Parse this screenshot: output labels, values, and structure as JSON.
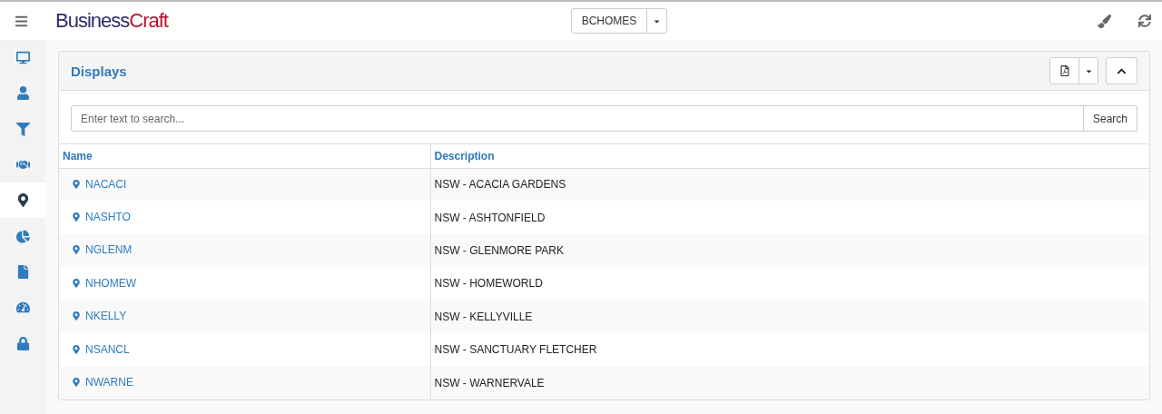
{
  "header": {
    "logo": {
      "text": "Business",
      "accent": "Craft"
    },
    "company": "BCHOMES"
  },
  "sidebar": {
    "items": [
      {
        "selected": false
      },
      {
        "selected": false
      },
      {
        "selected": false
      },
      {
        "selected": false
      },
      {
        "selected": true
      },
      {
        "selected": false
      },
      {
        "selected": false
      },
      {
        "selected": false
      },
      {
        "selected": false
      }
    ]
  },
  "panel": {
    "title": "Displays",
    "search": {
      "placeholder": "Enter text to search...",
      "button": "Search"
    },
    "table": {
      "columns": [
        "Name",
        "Description"
      ],
      "rows": [
        {
          "name": "NACACI",
          "description": "NSW - ACACIA GARDENS"
        },
        {
          "name": "NASHTO",
          "description": "NSW - ASHTONFIELD"
        },
        {
          "name": "NGLENM",
          "description": "NSW - GLENMORE PARK"
        },
        {
          "name": "NHOMEW",
          "description": "NSW - HOMEWORLD"
        },
        {
          "name": "NKELLY",
          "description": "NSW - KELLYVILLE"
        },
        {
          "name": "NSANCL",
          "description": "NSW - SANCTUARY FLETCHER"
        },
        {
          "name": "NWARNE",
          "description": "NSW - WARNERVALE"
        }
      ]
    }
  }
}
